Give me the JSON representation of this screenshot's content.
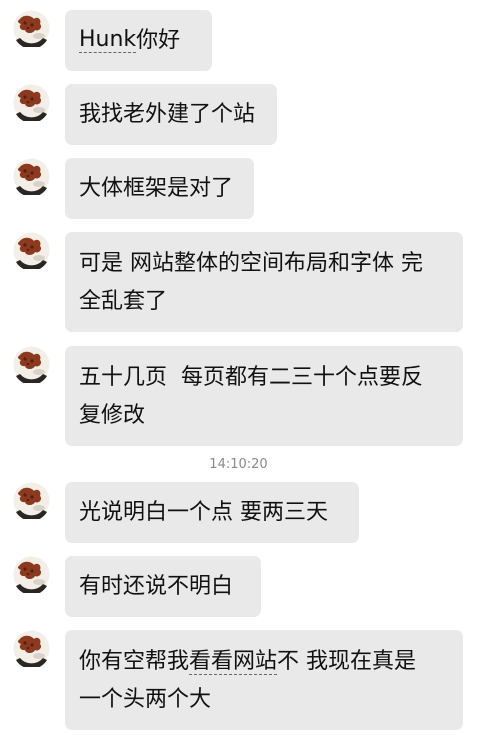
{
  "messages": [
    {
      "text": "Hunk 你好",
      "parts": [
        "Hunk",
        " 你好"
      ]
    },
    {
      "text": "我找老外建了个站"
    },
    {
      "text": "大体框架是对了"
    },
    {
      "text": "可是 网站整体的空间布局和字体 完全乱套了",
      "line1": "可是 网站整体的空间布局和字体 完",
      "line2": "全乱套了"
    },
    {
      "text": "五十几页  每页都有二三十个点要反复修改",
      "line1": "五十几页  每页都有二三十个点要反",
      "line2": "复修改"
    },
    {
      "text": "光说明白一个点 要两三天"
    },
    {
      "text": "有时还说不明白"
    },
    {
      "text": "你有空帮我看看网站不 我现在真是一个头两个大",
      "line1_a": "你有空帮我",
      "line1_b": "看看网站",
      "line1_c": "不 我现在真是",
      "line2": "一个头两个大"
    }
  ],
  "timestamp": "14:10:20",
  "avatar_icon": "cookie-avatar-icon",
  "colors": {
    "bubble": "#e9e9ea",
    "text": "#111111",
    "timestamp": "#8a8a8a",
    "background": "#ffffff"
  }
}
